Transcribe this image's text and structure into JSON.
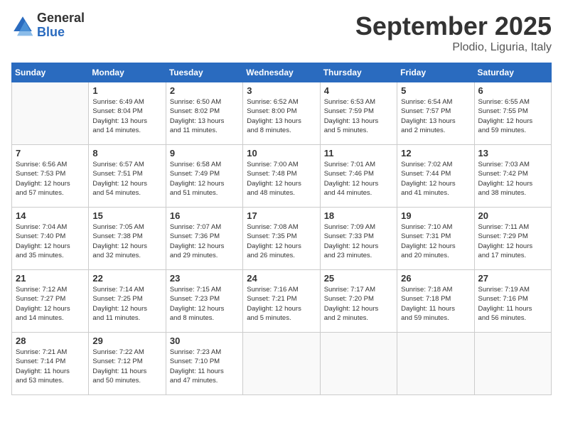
{
  "header": {
    "logo_general": "General",
    "logo_blue": "Blue",
    "month": "September 2025",
    "location": "Plodio, Liguria, Italy"
  },
  "days_of_week": [
    "Sunday",
    "Monday",
    "Tuesday",
    "Wednesday",
    "Thursday",
    "Friday",
    "Saturday"
  ],
  "weeks": [
    [
      {
        "day": "",
        "info": ""
      },
      {
        "day": "1",
        "info": "Sunrise: 6:49 AM\nSunset: 8:04 PM\nDaylight: 13 hours\nand 14 minutes."
      },
      {
        "day": "2",
        "info": "Sunrise: 6:50 AM\nSunset: 8:02 PM\nDaylight: 13 hours\nand 11 minutes."
      },
      {
        "day": "3",
        "info": "Sunrise: 6:52 AM\nSunset: 8:00 PM\nDaylight: 13 hours\nand 8 minutes."
      },
      {
        "day": "4",
        "info": "Sunrise: 6:53 AM\nSunset: 7:59 PM\nDaylight: 13 hours\nand 5 minutes."
      },
      {
        "day": "5",
        "info": "Sunrise: 6:54 AM\nSunset: 7:57 PM\nDaylight: 13 hours\nand 2 minutes."
      },
      {
        "day": "6",
        "info": "Sunrise: 6:55 AM\nSunset: 7:55 PM\nDaylight: 12 hours\nand 59 minutes."
      }
    ],
    [
      {
        "day": "7",
        "info": "Sunrise: 6:56 AM\nSunset: 7:53 PM\nDaylight: 12 hours\nand 57 minutes."
      },
      {
        "day": "8",
        "info": "Sunrise: 6:57 AM\nSunset: 7:51 PM\nDaylight: 12 hours\nand 54 minutes."
      },
      {
        "day": "9",
        "info": "Sunrise: 6:58 AM\nSunset: 7:49 PM\nDaylight: 12 hours\nand 51 minutes."
      },
      {
        "day": "10",
        "info": "Sunrise: 7:00 AM\nSunset: 7:48 PM\nDaylight: 12 hours\nand 48 minutes."
      },
      {
        "day": "11",
        "info": "Sunrise: 7:01 AM\nSunset: 7:46 PM\nDaylight: 12 hours\nand 44 minutes."
      },
      {
        "day": "12",
        "info": "Sunrise: 7:02 AM\nSunset: 7:44 PM\nDaylight: 12 hours\nand 41 minutes."
      },
      {
        "day": "13",
        "info": "Sunrise: 7:03 AM\nSunset: 7:42 PM\nDaylight: 12 hours\nand 38 minutes."
      }
    ],
    [
      {
        "day": "14",
        "info": "Sunrise: 7:04 AM\nSunset: 7:40 PM\nDaylight: 12 hours\nand 35 minutes."
      },
      {
        "day": "15",
        "info": "Sunrise: 7:05 AM\nSunset: 7:38 PM\nDaylight: 12 hours\nand 32 minutes."
      },
      {
        "day": "16",
        "info": "Sunrise: 7:07 AM\nSunset: 7:36 PM\nDaylight: 12 hours\nand 29 minutes."
      },
      {
        "day": "17",
        "info": "Sunrise: 7:08 AM\nSunset: 7:35 PM\nDaylight: 12 hours\nand 26 minutes."
      },
      {
        "day": "18",
        "info": "Sunrise: 7:09 AM\nSunset: 7:33 PM\nDaylight: 12 hours\nand 23 minutes."
      },
      {
        "day": "19",
        "info": "Sunrise: 7:10 AM\nSunset: 7:31 PM\nDaylight: 12 hours\nand 20 minutes."
      },
      {
        "day": "20",
        "info": "Sunrise: 7:11 AM\nSunset: 7:29 PM\nDaylight: 12 hours\nand 17 minutes."
      }
    ],
    [
      {
        "day": "21",
        "info": "Sunrise: 7:12 AM\nSunset: 7:27 PM\nDaylight: 12 hours\nand 14 minutes."
      },
      {
        "day": "22",
        "info": "Sunrise: 7:14 AM\nSunset: 7:25 PM\nDaylight: 12 hours\nand 11 minutes."
      },
      {
        "day": "23",
        "info": "Sunrise: 7:15 AM\nSunset: 7:23 PM\nDaylight: 12 hours\nand 8 minutes."
      },
      {
        "day": "24",
        "info": "Sunrise: 7:16 AM\nSunset: 7:21 PM\nDaylight: 12 hours\nand 5 minutes."
      },
      {
        "day": "25",
        "info": "Sunrise: 7:17 AM\nSunset: 7:20 PM\nDaylight: 12 hours\nand 2 minutes."
      },
      {
        "day": "26",
        "info": "Sunrise: 7:18 AM\nSunset: 7:18 PM\nDaylight: 11 hours\nand 59 minutes."
      },
      {
        "day": "27",
        "info": "Sunrise: 7:19 AM\nSunset: 7:16 PM\nDaylight: 11 hours\nand 56 minutes."
      }
    ],
    [
      {
        "day": "28",
        "info": "Sunrise: 7:21 AM\nSunset: 7:14 PM\nDaylight: 11 hours\nand 53 minutes."
      },
      {
        "day": "29",
        "info": "Sunrise: 7:22 AM\nSunset: 7:12 PM\nDaylight: 11 hours\nand 50 minutes."
      },
      {
        "day": "30",
        "info": "Sunrise: 7:23 AM\nSunset: 7:10 PM\nDaylight: 11 hours\nand 47 minutes."
      },
      {
        "day": "",
        "info": ""
      },
      {
        "day": "",
        "info": ""
      },
      {
        "day": "",
        "info": ""
      },
      {
        "day": "",
        "info": ""
      }
    ]
  ]
}
